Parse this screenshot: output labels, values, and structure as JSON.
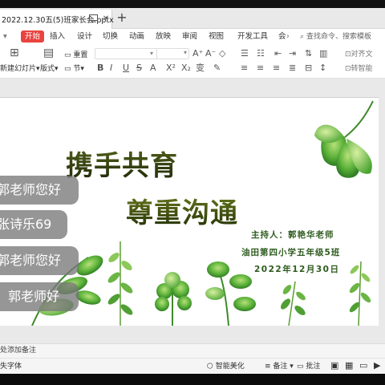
{
  "window": {
    "tab_title": "2022.12.30五(5)班家长会.pptx",
    "new_tab_glyph": "+"
  },
  "menu": {
    "start": "开始",
    "insert": "插入",
    "design": "设计",
    "transitions": "切换",
    "animation": "动画",
    "slideshow": "放映",
    "review": "审阅",
    "view": "视图",
    "developer": "开发工具",
    "member": "会",
    "search_placeholder": "查找命令、搜索模板"
  },
  "toolbar": {
    "new_slide": "新建幻灯片",
    "layout": "版式",
    "reset": "重置",
    "section": "节",
    "align_text": "对齐文",
    "convert_smartart": "转智能"
  },
  "slide": {
    "title_line1": "携手共育",
    "title_line2": "尊重沟通",
    "host": "主持人：郭艳华老师",
    "school": "油田第四小学五年级5班",
    "date": "2022年12月30日"
  },
  "comments": [
    "郭老师您好",
    "张诗乐69",
    "郭老师您好",
    "郭老师好"
  ],
  "notes_placeholder": "处添加备注",
  "status": {
    "font_missing": "失字体",
    "smart_beautify": "智能美化",
    "notes": "备注",
    "annotate": "批注"
  },
  "colors": {
    "accent_red": "#e8433e",
    "title_green": "#2c3a10",
    "host_green": "#2e5b1f"
  }
}
